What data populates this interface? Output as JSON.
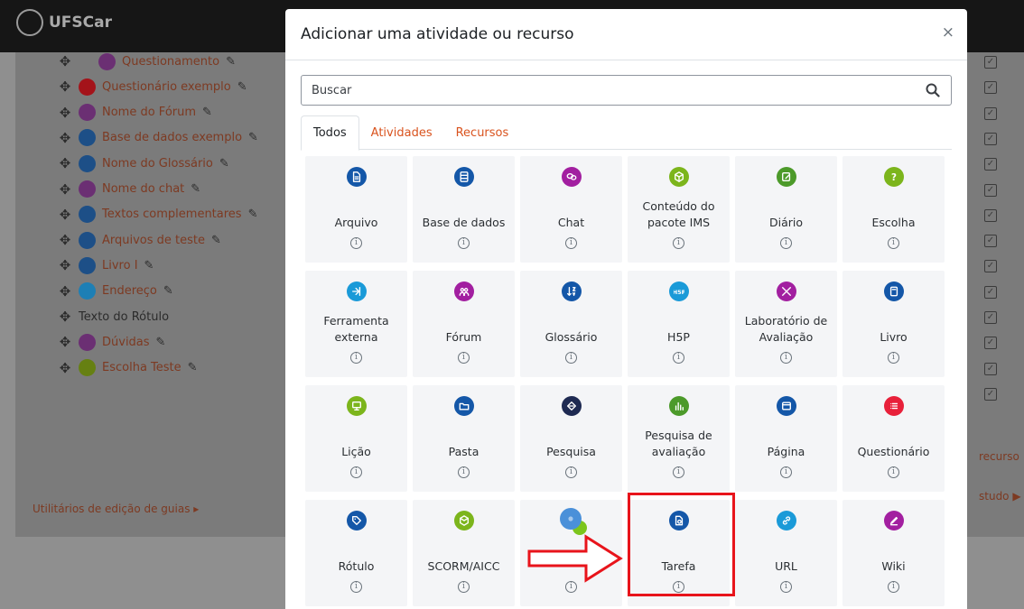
{
  "app": {
    "logo_text": "UFSCar"
  },
  "course_items": [
    {
      "label": "Questionamento",
      "color": "#6b2f73",
      "editable": true,
      "type": "forum"
    },
    {
      "label": "Questionário exemplo",
      "color": "#a4131a",
      "editable": true,
      "type": "quiz"
    },
    {
      "label": "Nome do Fórum",
      "color": "#6b2f73",
      "editable": true,
      "type": "forum"
    },
    {
      "label": "Base de dados exemplo",
      "color": "#1d4f87",
      "editable": true,
      "type": "database"
    },
    {
      "label": "Nome do Glossário",
      "color": "#1d4f87",
      "editable": true,
      "type": "glossary"
    },
    {
      "label": "Nome do chat",
      "color": "#6b2f73",
      "editable": true,
      "type": "chat"
    },
    {
      "label": "Textos complementares",
      "color": "#1d4f87",
      "editable": true,
      "type": "folder"
    },
    {
      "label": "Arquivos de teste",
      "color": "#1d4f87",
      "editable": true,
      "type": "folder"
    },
    {
      "label": "Livro I",
      "color": "#1d4f87",
      "editable": true,
      "type": "book"
    },
    {
      "label": "Endereço",
      "color": "#1d7fb5",
      "editable": true,
      "type": "url"
    },
    {
      "label": "Texto do Rótulo",
      "color": "",
      "editable": false,
      "type": "label"
    },
    {
      "label": "Dúvidas",
      "color": "#6b2f73",
      "editable": true,
      "type": "forum"
    },
    {
      "label": "Escolha Teste",
      "color": "#668012",
      "editable": true,
      "type": "choice"
    }
  ],
  "bg_links": {
    "guide_utilities": "Utilitários de edição de guias ▸",
    "add_resource": "recurso",
    "study": "studo ▶"
  },
  "modal": {
    "title": "Adicionar uma atividade ou recurso",
    "close_label": "×",
    "search_placeholder": "Buscar",
    "tabs": [
      "Todos",
      "Atividades",
      "Recursos"
    ],
    "active_tab": "Todos",
    "info_glyph": "i",
    "items": [
      {
        "label": "Arquivo",
        "color": "#1457a8",
        "icon": "file-icon"
      },
      {
        "label": "Base de dados",
        "color": "#1457a8",
        "icon": "database-icon"
      },
      {
        "label": "Chat",
        "color": "#a21fa0",
        "icon": "chat-icon"
      },
      {
        "label": "Conteúdo do\npacote IMS",
        "color": "#7cb51c",
        "icon": "package-icon"
      },
      {
        "label": "Diário",
        "color": "#4c9a2a",
        "icon": "journal-icon"
      },
      {
        "label": "Escolha",
        "color": "#7cb51c",
        "icon": "question-icon"
      },
      {
        "label": "Ferramenta\nexterna",
        "color": "#1a9ad8",
        "icon": "external-tool-icon"
      },
      {
        "label": "Fórum",
        "color": "#a21fa0",
        "icon": "forum-icon"
      },
      {
        "label": "Glossário",
        "color": "#1457a8",
        "icon": "glossary-icon"
      },
      {
        "label": "H5P",
        "color": "#1a9ad8",
        "icon": "h5p-icon"
      },
      {
        "label": "Laboratório de\nAvaliação",
        "color": "#a21fa0",
        "icon": "workshop-icon"
      },
      {
        "label": "Livro",
        "color": "#1457a8",
        "icon": "book-icon"
      },
      {
        "label": "Lição",
        "color": "#7cb51c",
        "icon": "lesson-icon"
      },
      {
        "label": "Pasta",
        "color": "#1457a8",
        "icon": "folder-icon"
      },
      {
        "label": "Pesquisa",
        "color": "#1e2a52",
        "icon": "survey-icon"
      },
      {
        "label": "Pesquisa de\navaliação",
        "color": "#4c9a2a",
        "icon": "feedback-icon"
      },
      {
        "label": "Página",
        "color": "#1457a8",
        "icon": "page-icon"
      },
      {
        "label": "Questionário",
        "color": "#e8203a",
        "icon": "quiz-icon"
      },
      {
        "label": "Rótulo",
        "color": "#1457a8",
        "icon": "label-icon"
      },
      {
        "label": "SCORM/AICC",
        "color": "#7cb51c",
        "icon": "scorm-icon"
      },
      {
        "label": "",
        "color": "#4a90d9",
        "icon": "subscribe-icon"
      },
      {
        "label": "Tarefa",
        "color": "#1457a8",
        "icon": "assignment-icon"
      },
      {
        "label": "URL",
        "color": "#1a9ad8",
        "icon": "link-icon"
      },
      {
        "label": "Wiki",
        "color": "#a21fa0",
        "icon": "wiki-icon"
      }
    ]
  },
  "annotation": {
    "highlighted_item": "Tarefa",
    "color": "#e8141b"
  }
}
